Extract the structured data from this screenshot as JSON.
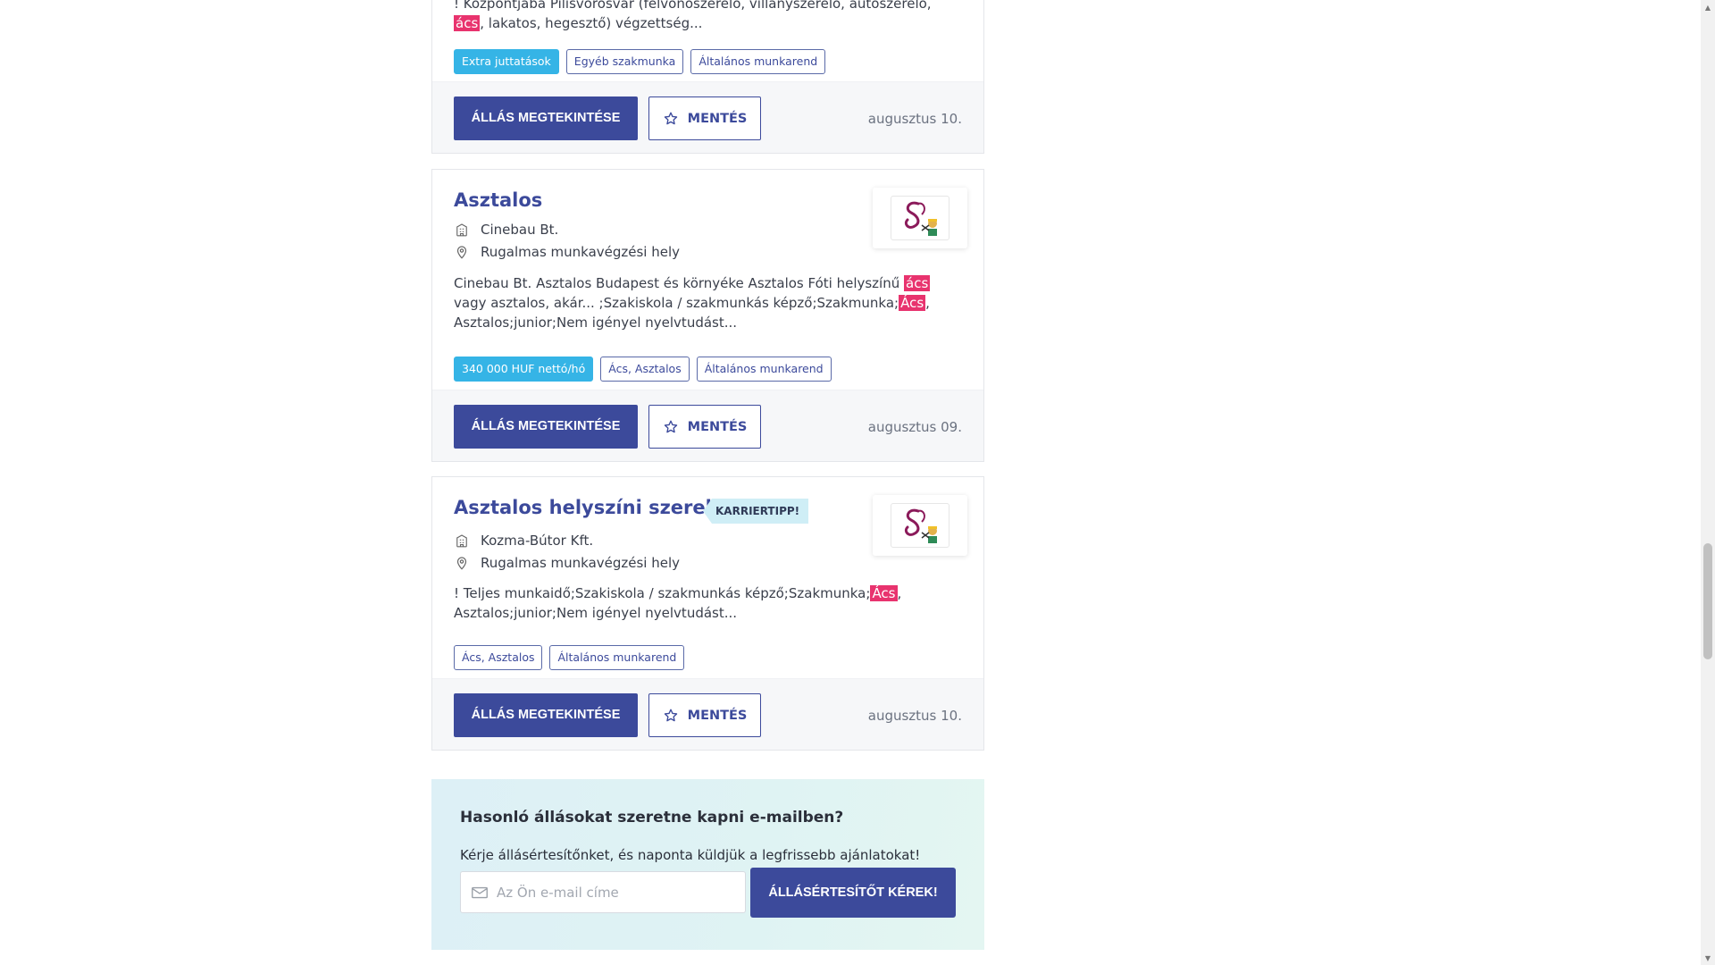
{
  "jobs": [
    {
      "title": "",
      "company": "",
      "location": "",
      "desc_parts": [
        "! Központjába Pilisvörösvár (felvonószerelő, villanyszerelő, autószerelő, ",
        "ács",
        ", lakatos, hegesztő) végzettség..."
      ],
      "tags": [
        "Extra juttatások",
        "Egyéb szakmunka",
        "Általános munkarend"
      ],
      "view_label": "ÁLLÁS MEGTEKINTÉSE",
      "save_label": "MENTÉS",
      "date": "augusztus 10."
    },
    {
      "title": "Asztalos",
      "company": "Cinebau Bt.",
      "location": "Rugalmas munkavégzési hely",
      "desc_parts": [
        "Cinebau Bt. Asztalos Budapest és környéke Asztalos Fóti helyszínű ",
        "ács",
        " vagy asztalos, akár... ;Szakiskola / szakmunkás képző;Szakmunka;",
        "Ács",
        ", Asztalos;junior;Nem igényel nyelvtudást..."
      ],
      "tags": [
        "340 000 HUF nettó/hó",
        "Ács, Asztalos",
        "Általános munkarend"
      ],
      "view_label": "ÁLLÁS MEGTEKINTÉSE",
      "save_label": "MENTÉS",
      "date": "augusztus 09."
    },
    {
      "title": "Asztalos helyszíni szerelő",
      "badge": "KARRIERTIPP!",
      "company": "Kozma-Bútor Kft.",
      "location": "Rugalmas munkavégzési hely",
      "desc_parts": [
        "!  Teljes munkaidő;Szakiskola / szakmunkás képző;Szakmunka;",
        "Ács",
        ", Asztalos;junior;Nem igényel nyelvtudást..."
      ],
      "tags": [
        "Ács, Asztalos",
        "Általános munkarend"
      ],
      "view_label": "ÁLLÁS MEGTEKINTÉSE",
      "save_label": "MENTÉS",
      "date": "augusztus 10."
    }
  ],
  "alert": {
    "title": "Hasonló állásokat szeretne kapni e-mailben?",
    "subtitle": "Kérje állásértesítőnket, és naponta küldjük a legfrissebb ajánlatokat!",
    "email_placeholder": "Az Ön e-mail címe",
    "button_label": "ÁLLÁSÉRTESÍTŐT KÉREK!"
  },
  "colors": {
    "primary": "#3c4a9b",
    "highlight": "#e8336e",
    "tag_solid": "#35b4e6"
  },
  "icons": [
    "building-icon",
    "location-pin-icon",
    "star-icon",
    "mail-icon",
    "company-logo"
  ]
}
